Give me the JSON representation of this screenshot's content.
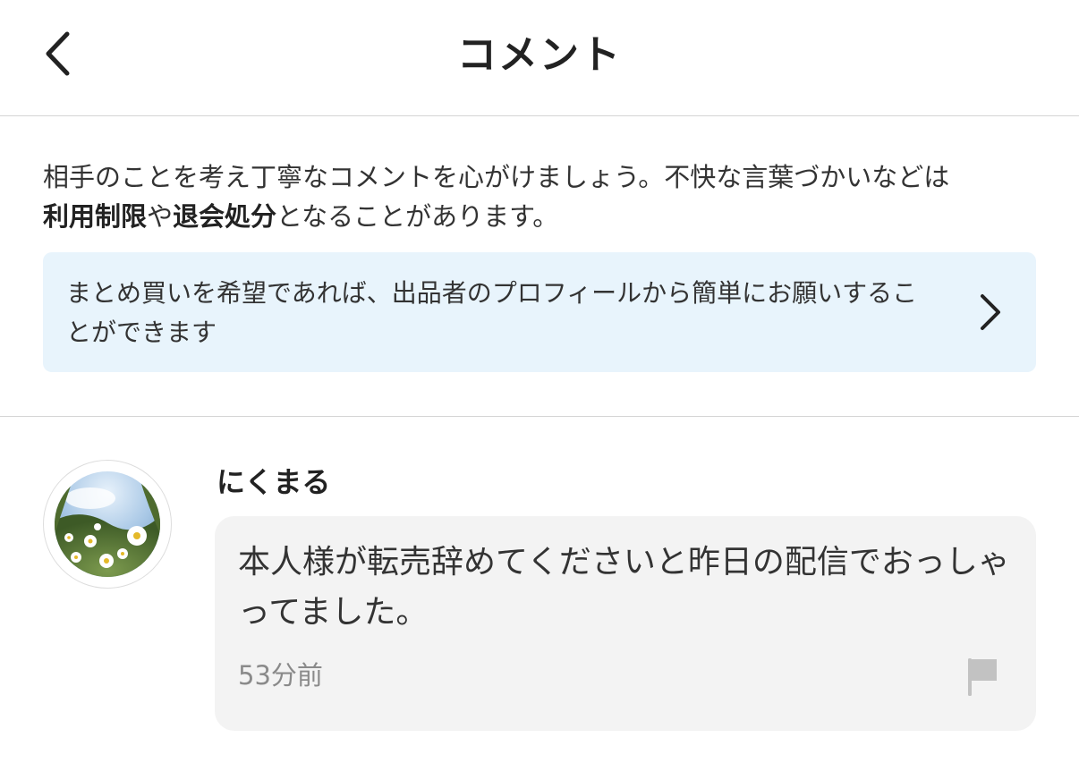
{
  "header": {
    "title": "コメント",
    "back_icon": "chevron-left-icon"
  },
  "notice": {
    "line1": "相手のことを考え丁寧なコメントを心がけましょう。不快な言葉づかいなどは",
    "bold1": "利用制限",
    "mid": "や",
    "bold2": "退会処分",
    "tail": "となることがあります。"
  },
  "banner": {
    "text": "まとめ買いを希望であれば、出品者のプロフィールから簡単にお願いすることができます",
    "chevron_icon": "chevron-right-icon",
    "background": "#e8f4fc"
  },
  "comment": {
    "username": "にくまる",
    "avatar_icon": "daisy-photo-avatar",
    "text": "本人様が転売辞めてくださいと昨日の配信でおっしゃってました。",
    "time": "53分前",
    "flag_icon": "flag-icon",
    "bubble_color": "#f3f3f3"
  }
}
